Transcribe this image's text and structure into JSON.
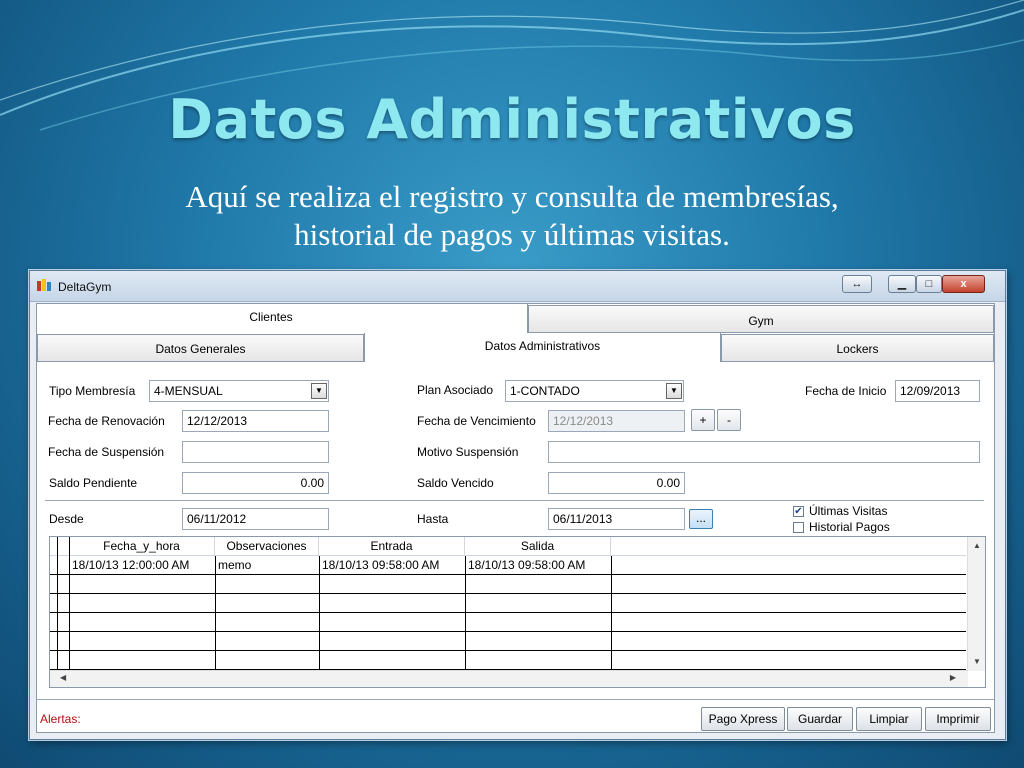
{
  "slide": {
    "title": "Datos Administrativos",
    "subtitle_line1": "Aquí se realiza el registro y consulta de membresías,",
    "subtitle_line2": "historial de pagos y últimas visitas."
  },
  "window": {
    "title": "DeltaGym",
    "close_glyph": "x"
  },
  "tabs_top": {
    "clientes": "Clientes",
    "gym": "Gym"
  },
  "tabs_sub": {
    "datos_generales": "Datos Generales",
    "datos_admin": "Datos Administrativos",
    "lockers": "Lockers"
  },
  "form": {
    "tipo_membresia_label": "Tipo Membresía",
    "tipo_membresia_value": "4-MENSUAL",
    "plan_asociado_label": "Plan Asociado",
    "plan_asociado_value": "1-CONTADO",
    "fecha_inicio_label": "Fecha de Inicio",
    "fecha_inicio_value": "12/09/2013",
    "fecha_renovacion_label": "Fecha de Renovación",
    "fecha_renovacion_value": "12/12/2013",
    "fecha_vencimiento_label": "Fecha de Vencimiento",
    "fecha_vencimiento_value": "12/12/2013",
    "plus_label": "+",
    "minus_label": "-",
    "fecha_suspension_label": "Fecha de Suspensión",
    "fecha_suspension_value": "",
    "motivo_suspension_label": "Motivo Suspensión",
    "motivo_suspension_value": "",
    "saldo_pendiente_label": "Saldo Pendiente",
    "saldo_pendiente_value": "0.00",
    "saldo_vencido_label": "Saldo Vencido",
    "saldo_vencido_value": "0.00",
    "desde_label": "Desde",
    "desde_value": "06/11/2012",
    "hasta_label": "Hasta",
    "hasta_value": "06/11/2013",
    "dots_label": "...",
    "ultimas_visitas_label": "Últimas Visitas",
    "ultimas_visitas_checked": true,
    "historial_pagos_label": "Historial Pagos",
    "historial_pagos_checked": false
  },
  "table": {
    "columns": [
      "Fecha_y_hora",
      "Observaciones",
      "Entrada",
      "Salida"
    ],
    "rows": [
      [
        "18/10/13 12:00:00 AM",
        "memo",
        "18/10/13 09:58:00 AM",
        "18/10/13 09:58:00 AM"
      ]
    ],
    "empty_rows": 5
  },
  "status": {
    "alertas_label": "Alertas:",
    "alert_color": "#b01010"
  },
  "buttons": {
    "pago_xpress": "Pago Xpress",
    "guardar": "Guardar",
    "limpiar": "Limpiar",
    "imprimir": "Imprimir"
  }
}
